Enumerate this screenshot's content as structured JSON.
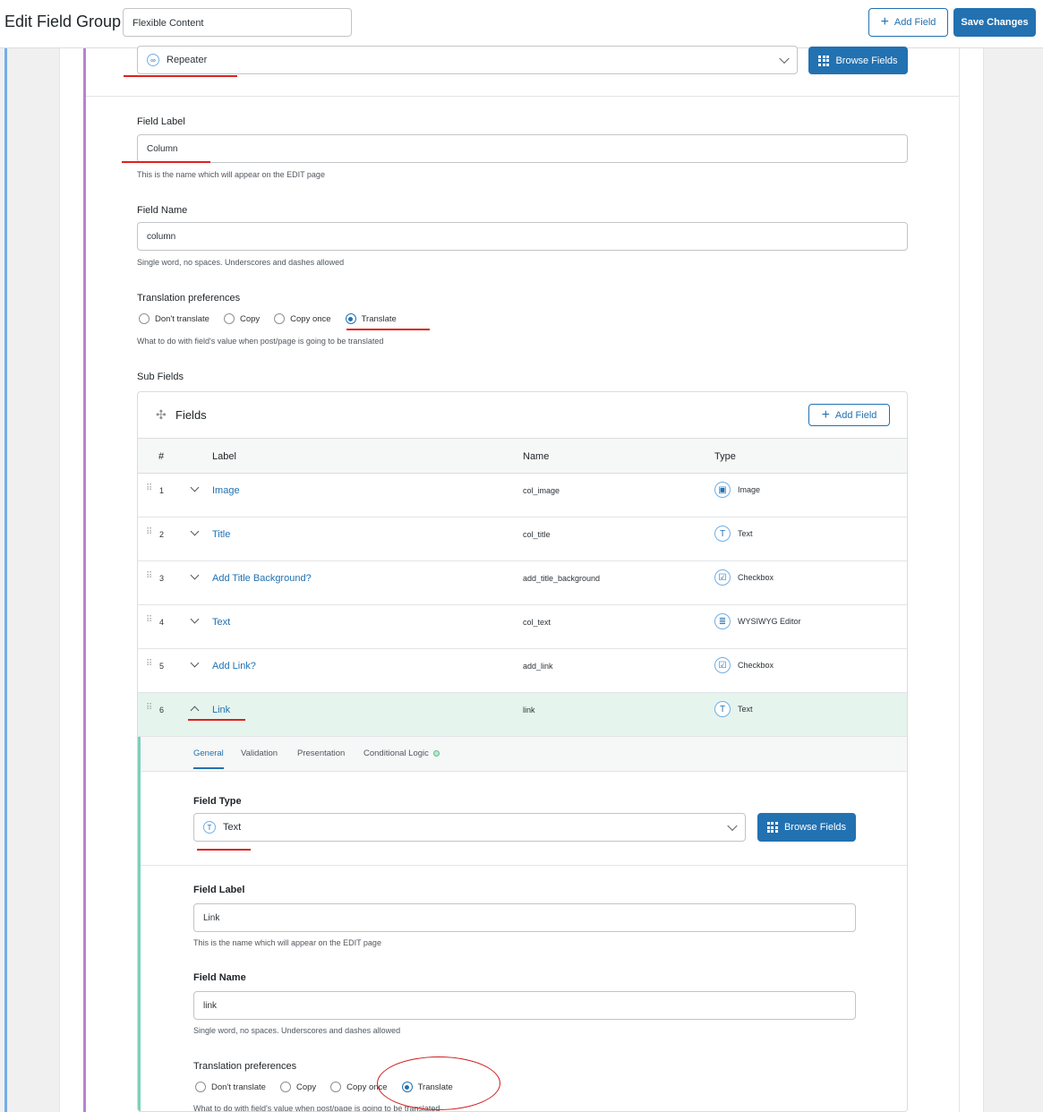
{
  "header": {
    "title": "Edit Field Group",
    "group_name": "Flexible Content",
    "add_field_label": "Add Field",
    "save_label": "Save Changes"
  },
  "top_field": {
    "type_value": "Repeater",
    "browse_label": "Browse Fields",
    "field_label_title": "Field Label",
    "field_label_value": "Column",
    "field_label_hint": "This is the name which will appear on the EDIT page",
    "field_name_title": "Field Name",
    "field_name_value": "column",
    "field_name_hint": "Single word, no spaces. Underscores and dashes allowed",
    "translation_title": "Translation preferences",
    "translation_options": [
      "Don't translate",
      "Copy",
      "Copy once",
      "Translate"
    ],
    "translation_selected": "Translate",
    "translation_hint": "What to do with field's value when post/page is going to be translated",
    "sub_fields_title": "Sub Fields"
  },
  "sub_fields": {
    "title": "Fields",
    "add_field_label": "Add Field",
    "columns": [
      "#",
      "Label",
      "Name",
      "Type"
    ],
    "rows": [
      {
        "num": "1",
        "label": "Image",
        "name": "col_image",
        "type": "Image",
        "icon": "image-icon"
      },
      {
        "num": "2",
        "label": "Title",
        "name": "col_title",
        "type": "Text",
        "icon": "text-icon"
      },
      {
        "num": "3",
        "label": "Add Title Background?",
        "name": "add_title_background",
        "type": "Checkbox",
        "icon": "checkbox-icon"
      },
      {
        "num": "4",
        "label": "Text",
        "name": "col_text",
        "type": "WYSIWYG Editor",
        "icon": "editor-icon"
      },
      {
        "num": "5",
        "label": "Add Link?",
        "name": "add_link",
        "type": "Checkbox",
        "icon": "checkbox-icon"
      },
      {
        "num": "6",
        "label": "Link",
        "name": "link",
        "type": "Text",
        "icon": "text-icon"
      }
    ]
  },
  "open_field": {
    "tabs": [
      "General",
      "Validation",
      "Presentation",
      "Conditional Logic"
    ],
    "field_type_title": "Field Type",
    "field_type_value": "Text",
    "browse_label": "Browse Fields",
    "field_label_title": "Field Label",
    "field_label_value": "Link",
    "field_label_hint": "This is the name which will appear on the EDIT page",
    "field_name_title": "Field Name",
    "field_name_value": "link",
    "field_name_hint": "Single word, no spaces. Underscores and dashes allowed",
    "translation_title": "Translation preferences",
    "translation_options": [
      "Don't translate",
      "Copy",
      "Copy once",
      "Translate"
    ],
    "translation_selected": "Translate",
    "translation_hint": "What to do with field's value when post/page is going to be translated"
  },
  "colors": {
    "accent": "#2271b1",
    "annotation": "#e0201d",
    "open_row": "#e6f4ee"
  }
}
